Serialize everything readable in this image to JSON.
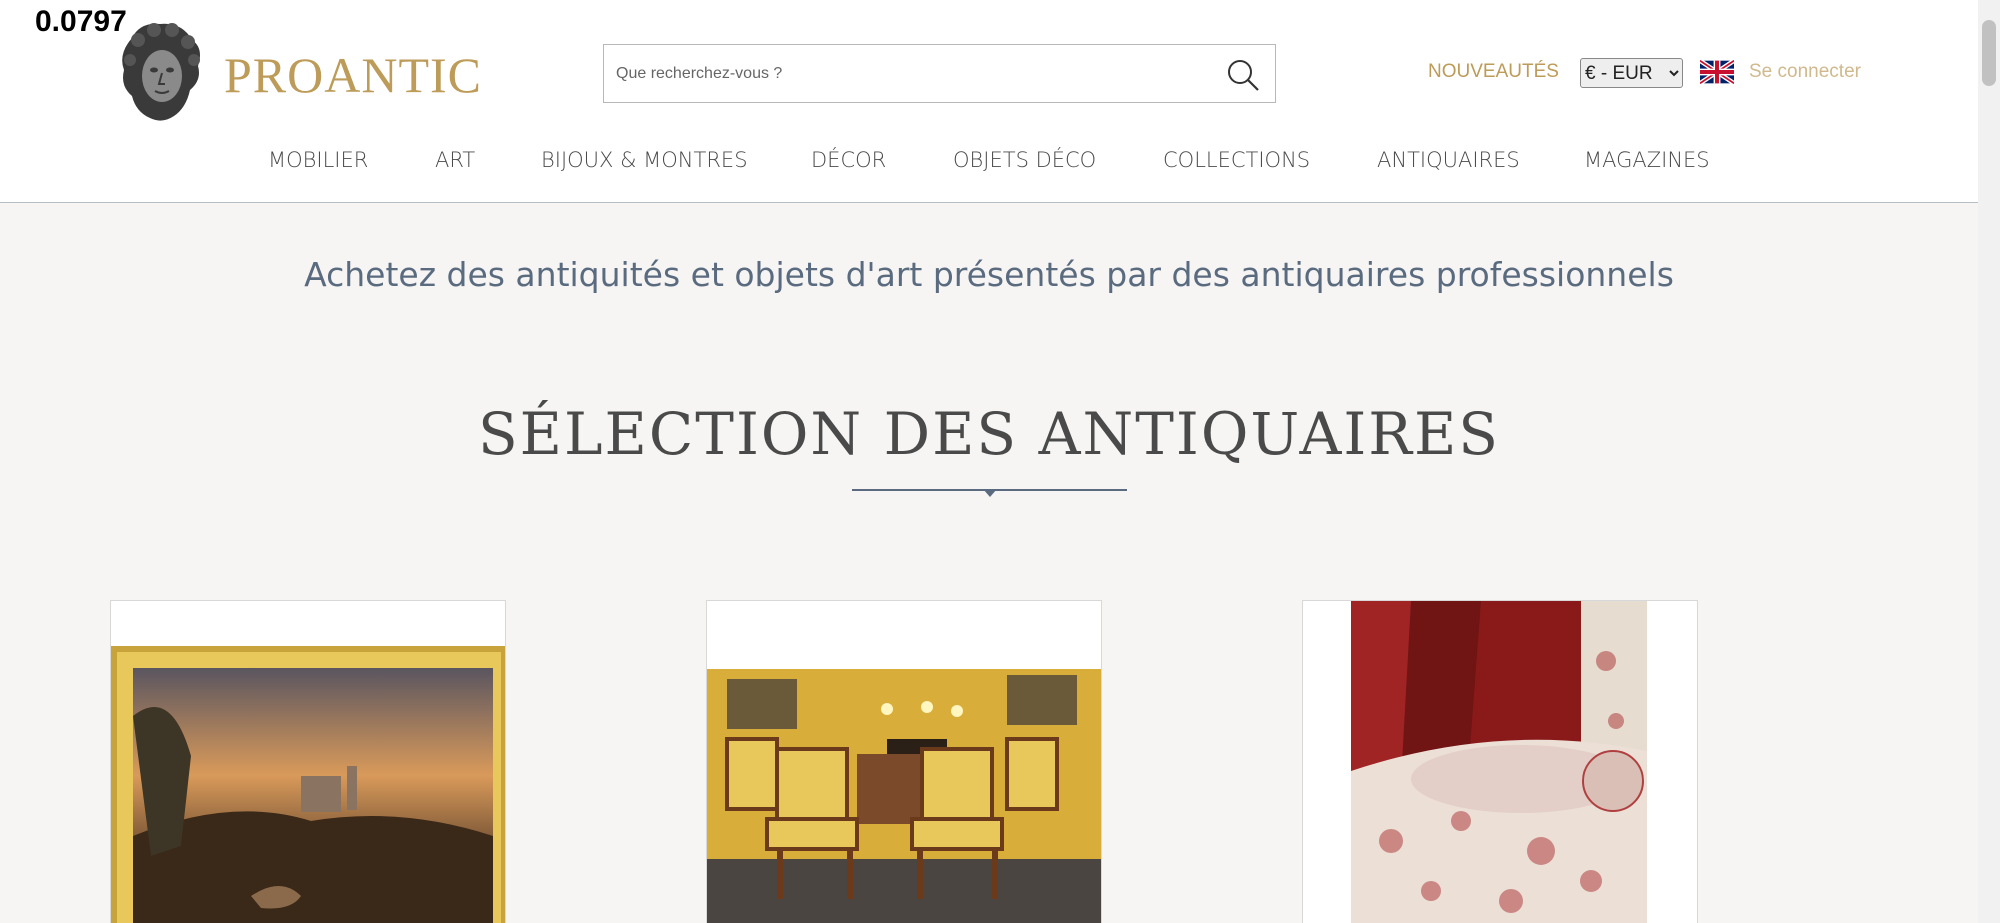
{
  "overlay": {
    "value": "0.0797"
  },
  "header": {
    "logo": "PROANTIC",
    "search_placeholder": "Que recherchez-vous ?",
    "nouveautes": "NOUVEAUTÉS",
    "currency": {
      "selected": "€ - EUR",
      "options": [
        "€ - EUR"
      ]
    },
    "login": "Se connecter"
  },
  "nav": {
    "items": [
      {
        "label": "MOBILIER"
      },
      {
        "label": "ART"
      },
      {
        "label": "BIJOUX & MONTRES"
      },
      {
        "label": "DÉCOR"
      },
      {
        "label": "OBJETS DÉCO"
      },
      {
        "label": "COLLECTIONS"
      },
      {
        "label": "ANTIQUAIRES"
      },
      {
        "label": "MAGAZINES"
      }
    ]
  },
  "main": {
    "tagline": "Achetez des antiquités et objets d'art présentés par des antiquaires professionnels",
    "section_title": "SÉLECTION DES ANTIQUAIRES"
  },
  "colors": {
    "brand_gold": "#bd9b58",
    "nav_text": "#4a4a4a",
    "accent_blue": "#5a6b80",
    "background": "#f6f5f3"
  },
  "icons": {
    "search": "search-icon",
    "flag": "uk-flag-icon",
    "logo": "bust-logo-icon"
  }
}
